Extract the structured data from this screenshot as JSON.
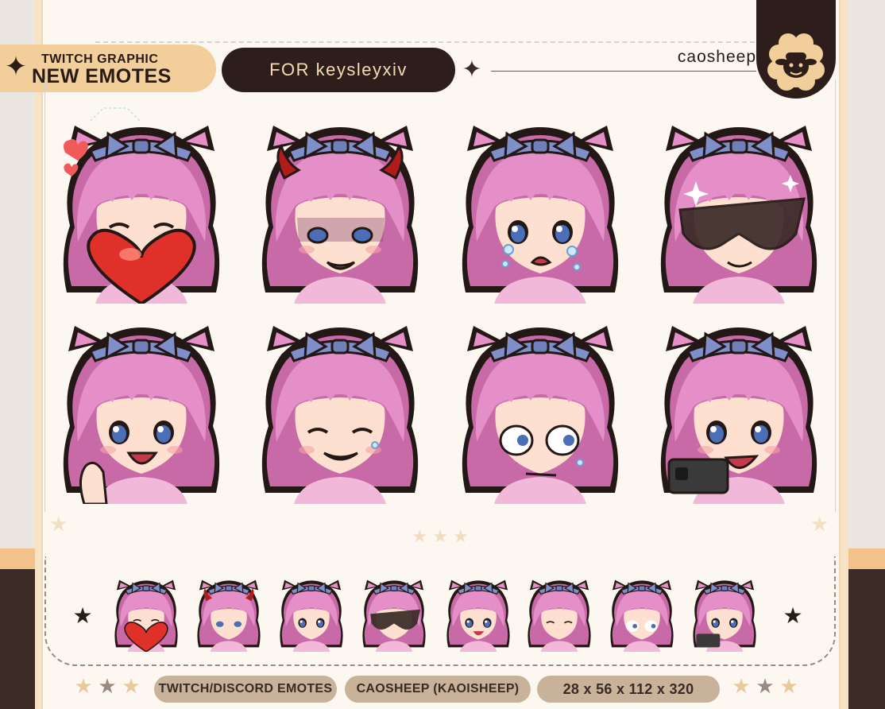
{
  "header": {
    "title_line1": "TWITCH GRAPHIC",
    "title_line2": "NEW EMOTES",
    "for_label": "FOR keysleyxiv",
    "brand": "caosheep",
    "logo_icon": "sheep-logo-icon"
  },
  "emotes": [
    {
      "name": "heart-hug",
      "bg": "#ffffff"
    },
    {
      "name": "devil-smirk",
      "bg": "#ffffff"
    },
    {
      "name": "crying",
      "bg": "#ffffff"
    },
    {
      "name": "sunglasses",
      "bg": "#ffffff"
    },
    {
      "name": "happy-wave",
      "bg": "#ffffff"
    },
    {
      "name": "smile-tear",
      "bg": "#ffffff"
    },
    {
      "name": "side-eye-sweat",
      "bg": "#ffffff"
    },
    {
      "name": "gun-shout",
      "bg": "#ffffff"
    }
  ],
  "colors": {
    "hair": "#e48fc8",
    "hair_shadow": "#c86aa8",
    "ribbon": "#7f8fc9",
    "skin": "#fde0cf",
    "outline": "#231815",
    "eye": "#4a6fb6",
    "accent_dark": "#2e1e1b",
    "accent_tan": "#f2cf9a"
  },
  "footer": {
    "pill1": "TWITCH/DISCORD EMOTES",
    "pill2": "CAOSHEEP (KAOISHEEP)",
    "pill3": "28 x 56 x 112 x 320"
  }
}
